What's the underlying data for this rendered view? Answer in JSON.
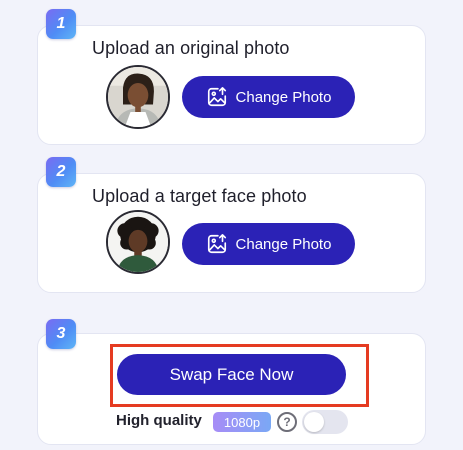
{
  "steps": [
    {
      "number": "1",
      "title": "Upload an original photo",
      "button_label": "Change Photo",
      "avatar_icon": "original-photo-thumbnail"
    },
    {
      "number": "2",
      "title": "Upload a target face photo",
      "button_label": "Change Photo",
      "avatar_icon": "target-face-thumbnail"
    },
    {
      "number": "3",
      "action_label": "Swap Face Now"
    }
  ],
  "quality": {
    "label": "High quality",
    "resolution_badge": "1080p",
    "help_icon": "question-circle-icon",
    "toggle_on": false
  },
  "colors": {
    "primary_button": "#2b22b6",
    "highlight_frame": "#e53b21",
    "page_background": "#f2f3fb",
    "badge_gradient_start": "#7a6bf2",
    "badge_gradient_end": "#5fb6f7"
  }
}
